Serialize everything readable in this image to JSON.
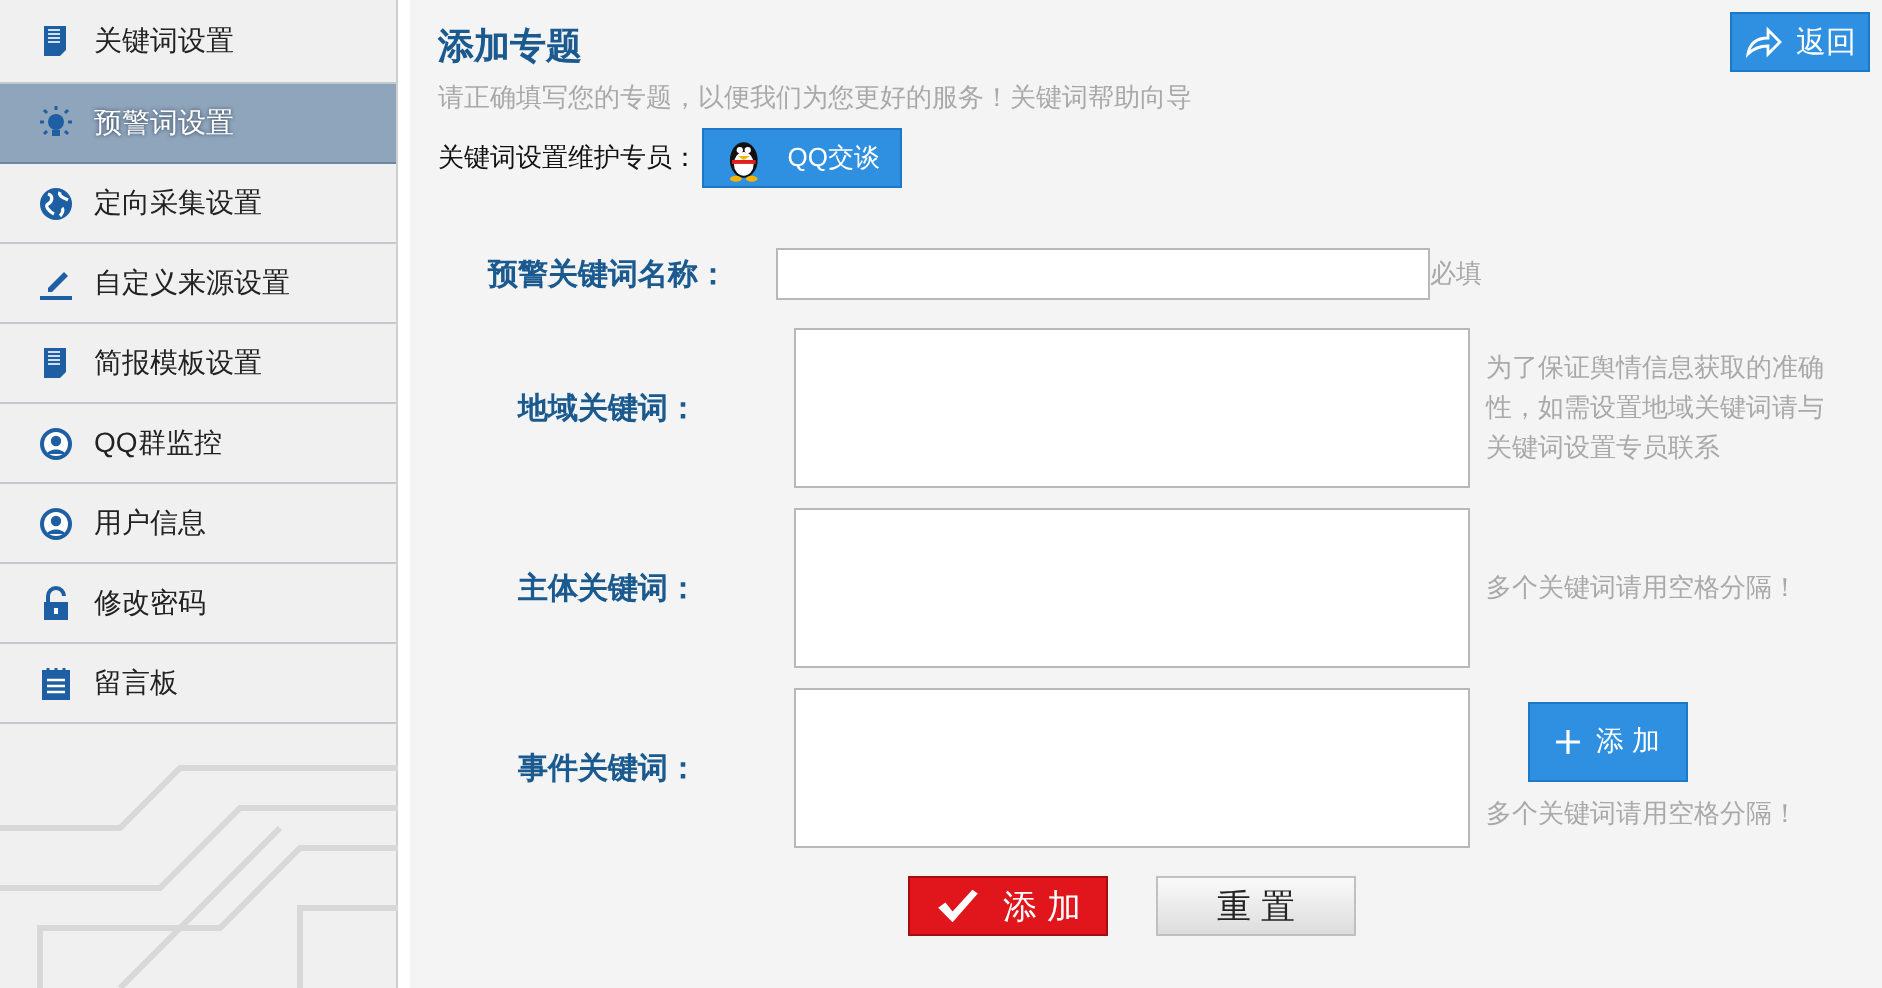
{
  "sidebar": {
    "items": [
      {
        "label": "关键词设置",
        "kind": "document",
        "selected": false
      },
      {
        "label": "预警词设置",
        "kind": "bulb",
        "selected": true
      },
      {
        "label": "定向采集设置",
        "kind": "globe",
        "selected": false
      },
      {
        "label": "自定义来源设置",
        "kind": "pen",
        "selected": false
      },
      {
        "label": "简报模板设置",
        "kind": "document",
        "selected": false
      },
      {
        "label": "QQ群监控",
        "kind": "user",
        "selected": false
      },
      {
        "label": "用户信息",
        "kind": "user",
        "selected": false
      },
      {
        "label": "修改密码",
        "kind": "lock",
        "selected": false
      },
      {
        "label": "留言板",
        "kind": "notepad",
        "selected": false
      }
    ]
  },
  "header": {
    "title": "添加专题",
    "back_button": "返回",
    "subtitle": "请正确填写您的专题，以便我们为您更好的服务！关键词帮助向导",
    "contact_label": "关键词设置维护专员：",
    "contact_button": "QQ交谈"
  },
  "form": {
    "rows": [
      {
        "kind": "input",
        "label": "预警关键词名称：",
        "hint": "必填"
      },
      {
        "kind": "textarea",
        "label": "地域关键词：",
        "hint": "为了保证舆情信息获取的准确性，如需设置地域关键词请与关键词设置专员联系"
      },
      {
        "kind": "textarea",
        "label": "主体关键词：",
        "hint": "多个关键词请用空格分隔！"
      },
      {
        "kind": "textarea",
        "label": "事件关键词：",
        "hint": "多个关键词请用空格分隔！",
        "add_button": "添 加"
      }
    ],
    "submit_button": "添 加",
    "reset_button": "重 置"
  }
}
